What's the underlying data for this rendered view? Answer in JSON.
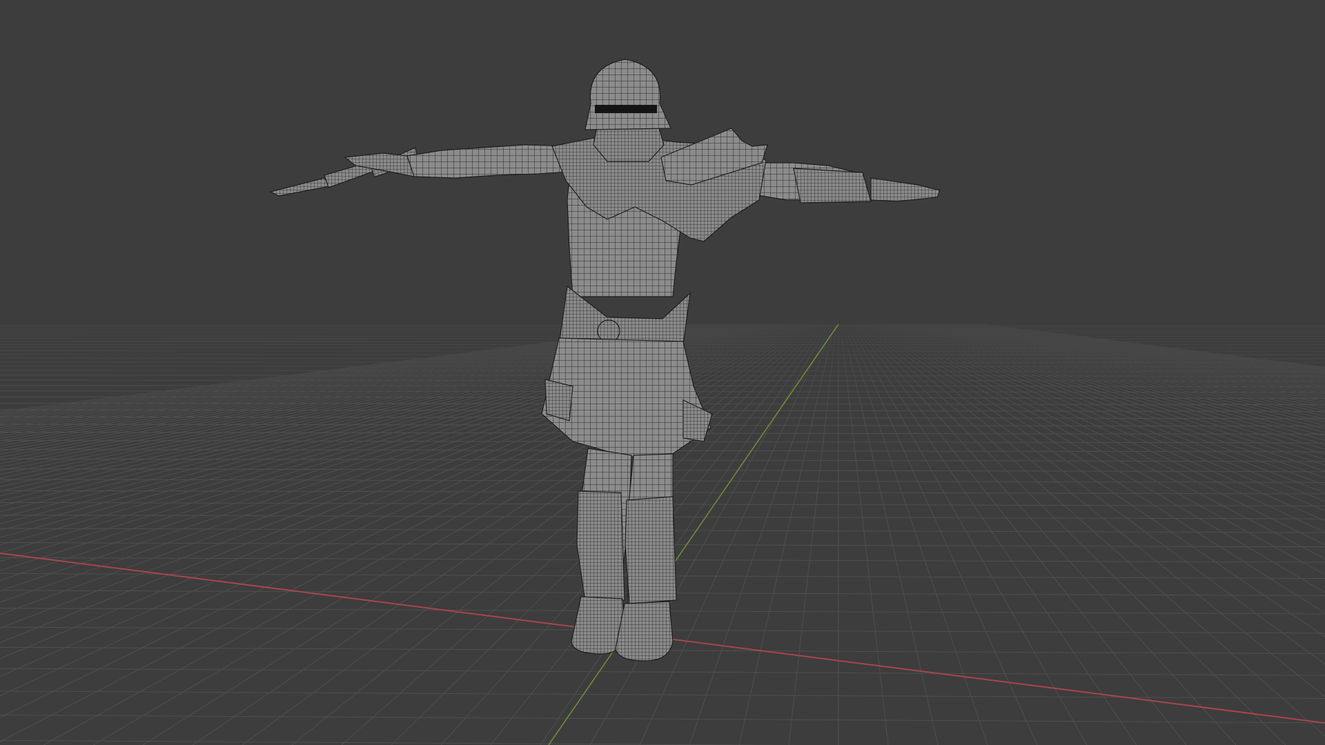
{
  "viewport": {
    "background_color": "#3d3d3d",
    "floor_grid_color": "#4f4f4f",
    "x_axis_color": "#a9454c",
    "y_axis_color": "#6f8b3a",
    "mesh_fill_color": "#8a8a8a",
    "mesh_wire_color": "#2b2b2b",
    "shading_mode": "wireframe-overlay",
    "scene_object": "armored-character-t-pose"
  }
}
